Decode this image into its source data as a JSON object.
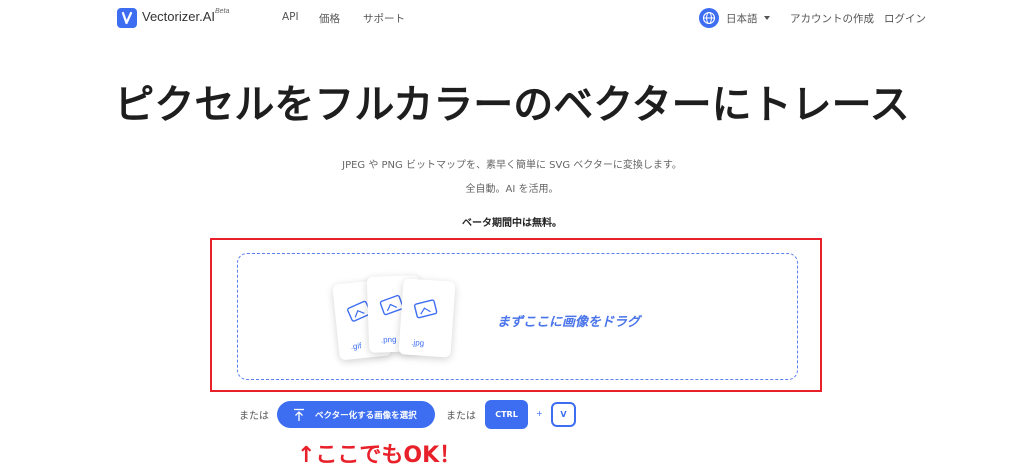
{
  "header": {
    "brand": "Vectorizer.AI",
    "beta": "Beta",
    "nav": [
      "API",
      "価格",
      "サポート"
    ],
    "language": "日本語",
    "create_account": "アカウントの作成",
    "login": "ログイン"
  },
  "hero": {
    "title": "ピクセルをフルカラーのベクターにトレース",
    "subtitle_line1": "JPEG や PNG ビットマップを、素早く簡単に SVG ベクターに変換します。",
    "subtitle_line2": "全自動。AI を活用。",
    "free_note": "ベータ期間中は無料。"
  },
  "upload": {
    "drag_text": "まずここに画像をドラグ",
    "file_types": [
      ".gif",
      ".png",
      ".jpg"
    ],
    "or_label_1": "または",
    "select_button": "ベクター化する画像を選択",
    "or_label_2": "または",
    "ctrl_key": "CTRL",
    "plus": "+",
    "v_key": "V"
  },
  "annotation": {
    "note": "↑ここでもOK！"
  },
  "colors": {
    "accent": "#3d6ef2",
    "highlight_frame": "#e8202a"
  }
}
